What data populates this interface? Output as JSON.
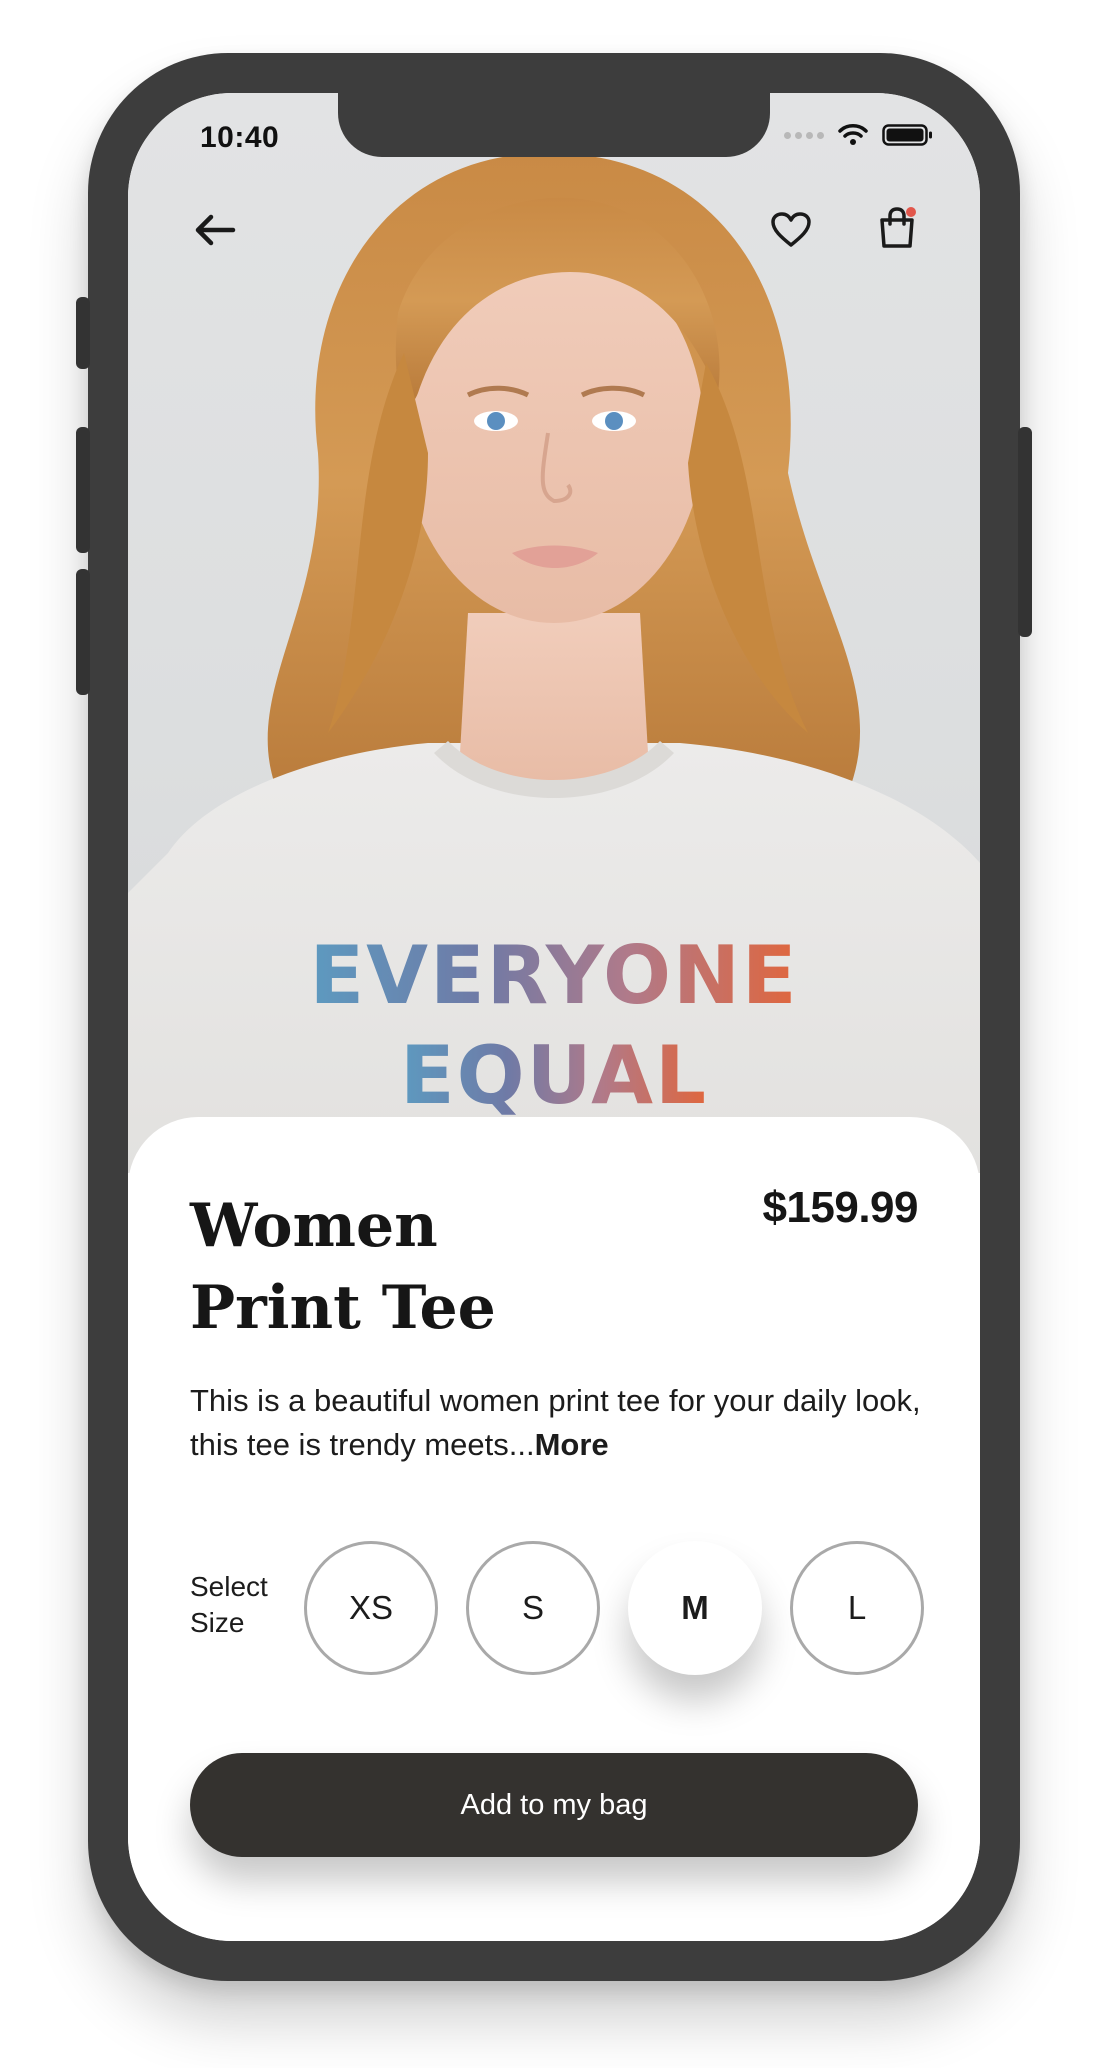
{
  "status_bar": {
    "time": "10:40",
    "icons": [
      "signal-dots-icon",
      "wifi-icon",
      "battery-icon"
    ]
  },
  "nav": {
    "back_icon": "arrow-left-icon",
    "favorite_icon": "heart-icon",
    "bag_icon": "shopping-bag-icon",
    "bag_badge_color": "#e2574c"
  },
  "product_image": {
    "shirt_text_line1": "EVERYONE",
    "shirt_text_line2": "EQUAL"
  },
  "product": {
    "title_line1": "Women",
    "title_line2": "Print Tee",
    "price": "$159.99",
    "description": "This is a beautiful women print tee for your daily look, this tee is trendy meets...",
    "more_label": "More"
  },
  "size_selector": {
    "label_line1": "Select",
    "label_line2": "Size",
    "options": [
      "XS",
      "S",
      "M",
      "L"
    ],
    "selected": "M"
  },
  "cta": {
    "label": "Add to my bag",
    "background": "#34322f"
  },
  "colors": {
    "frame": "#3d3d3d",
    "text": "#161616",
    "size_border": "#a9a9a9"
  }
}
